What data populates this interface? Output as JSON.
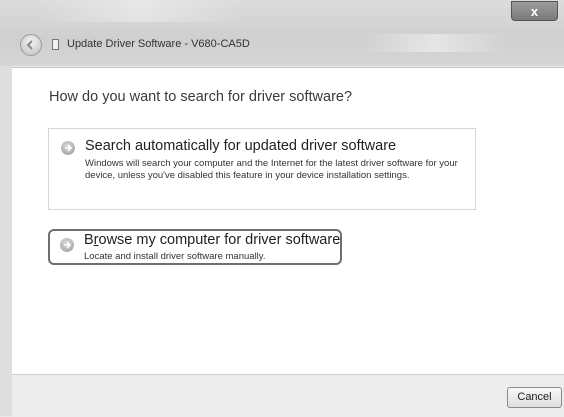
{
  "window": {
    "title": "Update Driver Software - V680-CA5D",
    "close_glyph": "x"
  },
  "main": {
    "heading": "How do you want to search for driver software?",
    "options": [
      {
        "title": "Search automatically for updated driver software",
        "description": "Windows will search your computer and the Internet for the latest driver software for your device, unless you've disabled this feature in your device installation settings.",
        "icon": "green-arrow-icon"
      },
      {
        "title_prefix": "B",
        "title_accel": "r",
        "title_rest": "owse my computer for driver software",
        "description": "Locate and install driver software manually.",
        "icon": "green-arrow-icon"
      }
    ]
  },
  "footer": {
    "cancel_label": "Cancel"
  },
  "colors": {
    "highlight_border": "#6f6f6f",
    "content_bg": "#ffffff",
    "footer_bg": "#ececec"
  }
}
